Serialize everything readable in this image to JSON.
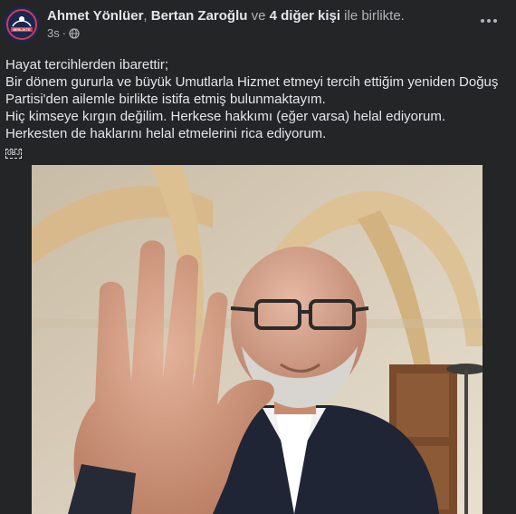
{
  "post": {
    "author": "Ahmet Yönlüer",
    "tag_separator": ", ",
    "tagged_person": "Bertan Zaroğlu",
    "and_word": " ve ",
    "others_count": "4 diğer kişi",
    "with_phrase": " ile birlikte.",
    "time": "3s",
    "dot": "·",
    "privacy_icon": "globe-icon",
    "avatar_text": "BİRİLİKTE",
    "text_lines": [
      "Hayat tercihlerden ibarettir;",
      "Bir dönem gururla ve büyük Umutlarla Hizmet etmeyi tercih ettiğim yeniden Doğuş Partisi'den ailemle birlikte istifa etmiş bulunmaktayım.",
      "Hiç kimseye kırgın değilim. Herkese hakkımı (eğer varsa) helal ediyorum. Herkesten de haklarını helal etmelerini rica ediyorum."
    ],
    "obj_tag": "OBJ"
  },
  "colors": {
    "background": "#242526",
    "primary_text": "#e4e6eb",
    "secondary_text": "#b0b3b8"
  }
}
